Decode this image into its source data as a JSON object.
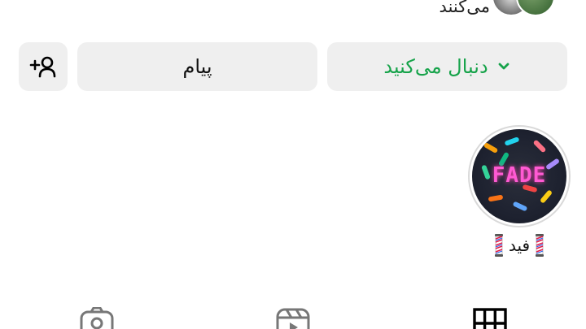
{
  "followers_strip": {
    "text": "می‌کنند"
  },
  "actions": {
    "follow_label": "دنبال می‌کنید",
    "message_label": "پیام"
  },
  "highlight": {
    "cover_text": "FADE",
    "label": "فید"
  },
  "colors": {
    "follow_green": "#16a34a",
    "button_bg": "#efefef"
  },
  "icons": {
    "add_person": "add-person-icon",
    "chevron": "chevron-down-icon",
    "tagged": "tagged-icon",
    "reels": "reels-icon",
    "grid": "grid-icon"
  }
}
